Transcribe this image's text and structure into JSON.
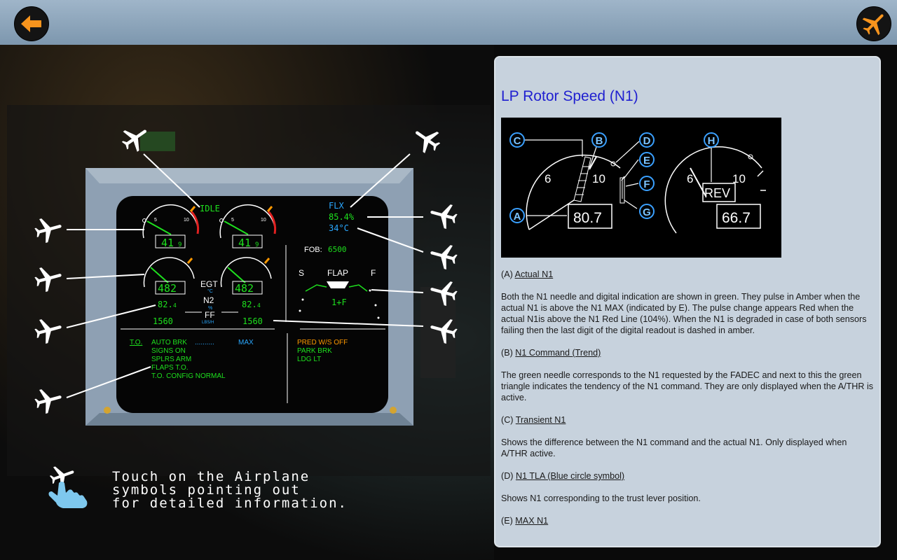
{
  "hint": {
    "line1": "Touch on the Airplane",
    "line2": "symbols pointing out",
    "line3": "for detailed information."
  },
  "ecam": {
    "idle": "IDLE",
    "flx": "FLX",
    "flx_pct": "85.4%",
    "flx_temp": "34°C",
    "n1_left": "41",
    "n1_left_dec": "9",
    "n1_right": "41",
    "n1_right_dec": "9",
    "egt_left": "482",
    "egt_right": "482",
    "egt_label": "EGT",
    "egt_unit": "°C",
    "n2_label": "N2",
    "n2_unit": "%",
    "n2_left": "82.",
    "n2_left_dec": "4",
    "n2_right": "82.",
    "n2_right_dec": "4",
    "ff_label": "FF",
    "ff_unit": "LBS/H",
    "ff_left": "1560",
    "ff_right": "1560",
    "fob_label": "FOB:",
    "fob_value": "6500",
    "flap_s": "S",
    "flap_label": "FLAP",
    "flap_f": "F",
    "flap_setting": "1+F",
    "to_label": "T.O.",
    "auto_brk": "AUTO BRK",
    "auto_brk_dots": "..........",
    "auto_brk_val": "MAX",
    "memo_left": [
      "SIGNS ON",
      "SPLRS ARM",
      "FLAPS T.O.",
      "T.O. CONFIG NORMAL"
    ],
    "memo_right_pred": "PRED W/S OFF",
    "memo_right": [
      "PARK BRK",
      "LDG LT"
    ]
  },
  "panel": {
    "title": "LP Rotor Speed (N1)",
    "diagram": {
      "labels": [
        "C",
        "B",
        "D",
        "E",
        "F",
        "A",
        "G",
        "H"
      ],
      "tick_6": "6",
      "tick_10": "10",
      "n1_value": "80.7",
      "rev": "REV",
      "rev_value": "66.7"
    },
    "sections": [
      {
        "prefix": "(A) ",
        "heading": "Actual N1",
        "body": "Both the N1 needle and digital indication are shown in green. They pulse in Amber when the actual N1 is above the N1 MAX (indicated by E). The pulse change appears Red when the actual N1is above the N1 Red Line (104%). When the N1 is degraded in case of both sensors failing then the last digit of the digital readout is dashed in amber."
      },
      {
        "prefix": "(B) ",
        "heading": "N1 Command (Trend)",
        "body": "The green needle corresponds to the N1 requested by the FADEC and next to this the green triangle indicates the tendency of the N1 command. They are only displayed when the A/THR is active."
      },
      {
        "prefix": "(C) ",
        "heading": "Transient N1",
        "body": "Shows the difference between the N1 command and the actual N1. Only displayed when A/THR active."
      },
      {
        "prefix": "(D) ",
        "heading": "N1 TLA (Blue circle symbol)",
        "body": "Shows N1 corresponding to the trust lever position."
      },
      {
        "prefix": "(E) ",
        "heading": "MAX N1",
        "body": ""
      }
    ]
  },
  "colors": {
    "accent_orange": "#f7941d",
    "ecam_green": "#1ee01e",
    "ecam_cyan": "#2aa8ff",
    "ecam_amber": "#ff9900",
    "title_blue": "#1f1fd0"
  },
  "icons": {
    "back": "arrow-left-icon",
    "menu": "airplane-icon",
    "marker": "airplane-icon",
    "hint": "touch-hand-icon"
  }
}
